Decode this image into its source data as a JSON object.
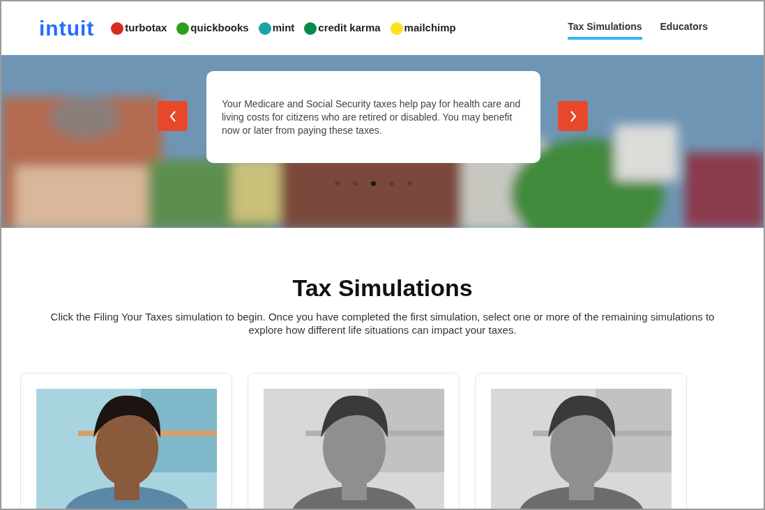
{
  "header": {
    "logo": "intuit",
    "brands": [
      {
        "name": "turbotax",
        "color": "#d52b1e"
      },
      {
        "name": "quickbooks",
        "color": "#2ca01c"
      },
      {
        "name": "mint",
        "color": "#1aa3a3"
      },
      {
        "name": "credit karma",
        "color": "#078a4a"
      },
      {
        "name": "mailchimp",
        "color": "#ffe01b"
      }
    ],
    "nav": [
      {
        "label": "Tax Simulations",
        "selected": true
      },
      {
        "label": "Educators",
        "selected": false
      }
    ]
  },
  "carousel": {
    "text": "Your Medicare and Social Security taxes help pay for health care and living costs for citizens who are retired or disabled. You may benefit now or later from paying these taxes.",
    "dots": [
      {
        "selected": false
      },
      {
        "selected": false
      },
      {
        "selected": true
      },
      {
        "selected": false
      },
      {
        "selected": false
      }
    ]
  },
  "section": {
    "title": "Tax Simulations",
    "intro": "Click the Filing Your Taxes simulation to begin. Once you have completed the first simulation, select one or more of the remaining simulations to explore how different life situations can impact your taxes.",
    "cards": [
      {
        "kind": "picture",
        "locked": false
      },
      {
        "kind": "picture",
        "locked": true
      },
      {
        "kind": "picture",
        "locked": true
      }
    ]
  }
}
